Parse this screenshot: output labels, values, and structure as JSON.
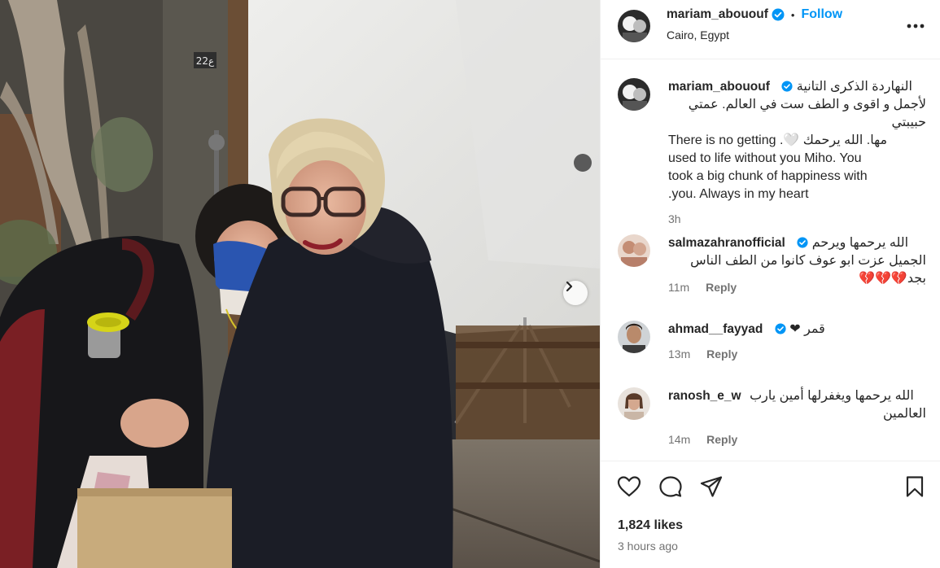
{
  "post": {
    "image_alt": "Two women embracing at night on a film set",
    "door_number": "22ع"
  },
  "header": {
    "username": "mariam_abououf",
    "dot": "•",
    "follow_label": "Follow",
    "location": "Cairo, Egypt"
  },
  "caption": {
    "username": "mariam_abououf",
    "lines": [
      "النهاردة الذكرى التانية",
      "لأجمل و اقوى و الطف ست في العالم. عمتي حبيبتي",
      "There is no getting .‫مها. الله يرحمك 🤍‬",
      "used to life without you Miho. You",
      "took a big chunk of happiness with",
      ".you. Always in my heart"
    ],
    "time": "3h"
  },
  "comments": [
    {
      "username": "salmazahranofficial",
      "lines": [
        "الله يرحمها ويرحم",
        "الجميل عزت ابو عوف كانوا من الطف الناس بجد💔💔💔"
      ],
      "time": "11m",
      "reply": "Reply"
    },
    {
      "username": "ahmad__fayyad",
      "lines": [
        "قمر ❤"
      ],
      "time": "13m",
      "reply": "Reply"
    },
    {
      "username": "ranosh_e_w",
      "lines": [
        "الله يرحمها ويغفرلها أمين يارب",
        "العالمين"
      ],
      "time": "14m",
      "reply": "Reply"
    }
  ],
  "stats": {
    "likes": "1,824 likes",
    "time_ago": "3 hours ago"
  },
  "icons": {
    "verified_color": "#0095f6",
    "link_color": "#0095f6"
  }
}
